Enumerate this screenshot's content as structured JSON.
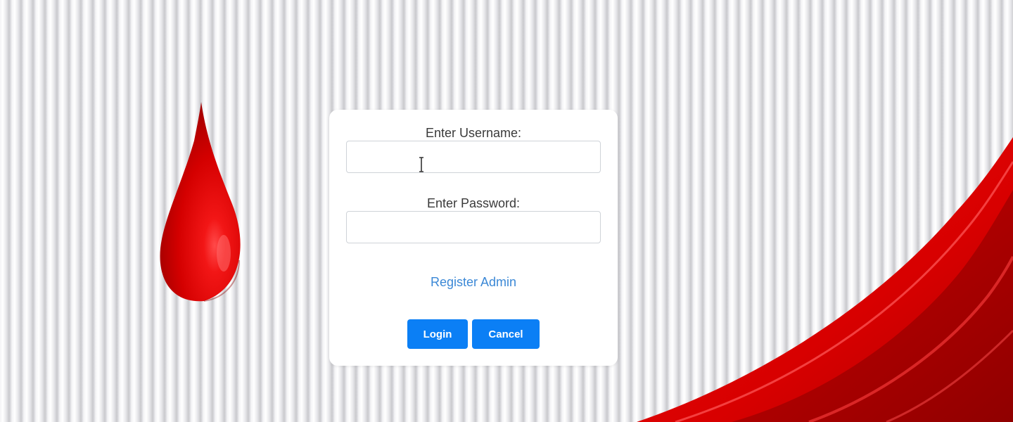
{
  "form": {
    "username_label": "Enter Username:",
    "username_value": "",
    "password_label": "Enter Password:",
    "password_value": "",
    "register_link": "Register Admin",
    "login_button": "Login",
    "cancel_button": "Cancel"
  },
  "decor": {
    "blood_drop_icon": "blood-drop-icon",
    "ribbon": "red-ribbon-wave"
  },
  "colors": {
    "accent": "#0b7ff5",
    "link": "#3b88d6",
    "brand_red": "#e00a0a",
    "card_bg": "#ffffff"
  }
}
